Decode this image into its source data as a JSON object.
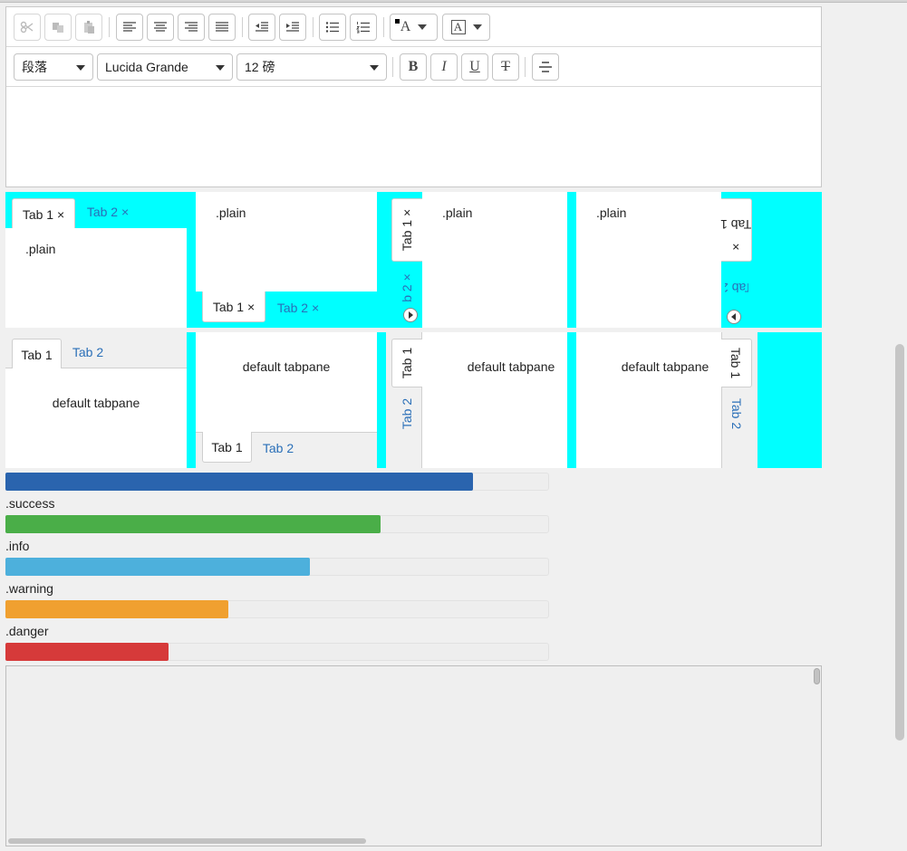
{
  "colors": {
    "accent_cyan": "#00ffff",
    "link": "#2a6fb8",
    "progress_default": "#2a64ae",
    "progress_success": "#4aae48",
    "progress_info": "#4db0dc",
    "progress_warning": "#f0a030",
    "progress_danger": "#d63a3a"
  },
  "toolbar": {
    "icons": [
      "scissors-icon",
      "copy-icon",
      "paste-icon",
      "align-left-icon",
      "align-center-icon",
      "align-right-icon",
      "align-justify-icon",
      "outdent-icon",
      "indent-icon",
      "bullet-list-icon",
      "numbered-list-icon",
      "font-color-icon",
      "highlight-icon"
    ],
    "paragraph_select": "段落",
    "font_select": "Lucida Grande",
    "size_select": "12 磅",
    "bold_label": "B",
    "italic_label": "I",
    "underline_label": "U",
    "strike_label": "T",
    "font_color_letter": "A",
    "highlight_letter": "A"
  },
  "tabs_top": {
    "tab1": "Tab 1",
    "tab2": "Tab 2",
    "close": "×",
    "pane": ".plain"
  },
  "tabs_bottom": {
    "tab1": "Tab 1",
    "tab2": "Tab 2",
    "close": "×",
    "pane": ".plain"
  },
  "tabs_left": {
    "tab1": "Tab 1",
    "tab2_partial": "b 2",
    "close": "×",
    "pane": ".plain"
  },
  "tabs_right": {
    "tab1": "Tab 1",
    "tab2": "Tab 2",
    "close": "×",
    "pane": ".plain"
  },
  "default_tabs": {
    "tab1": "Tab 1",
    "tab2": "Tab 2",
    "pane": "default tabpane"
  },
  "progress": [
    {
      "label": "",
      "value": 0.86
    },
    {
      "label": ".success",
      "value": 0.69
    },
    {
      "label": ".info",
      "value": 0.56
    },
    {
      "label": ".warning",
      "value": 0.41
    },
    {
      "label": ".danger",
      "value": 0.3
    }
  ]
}
